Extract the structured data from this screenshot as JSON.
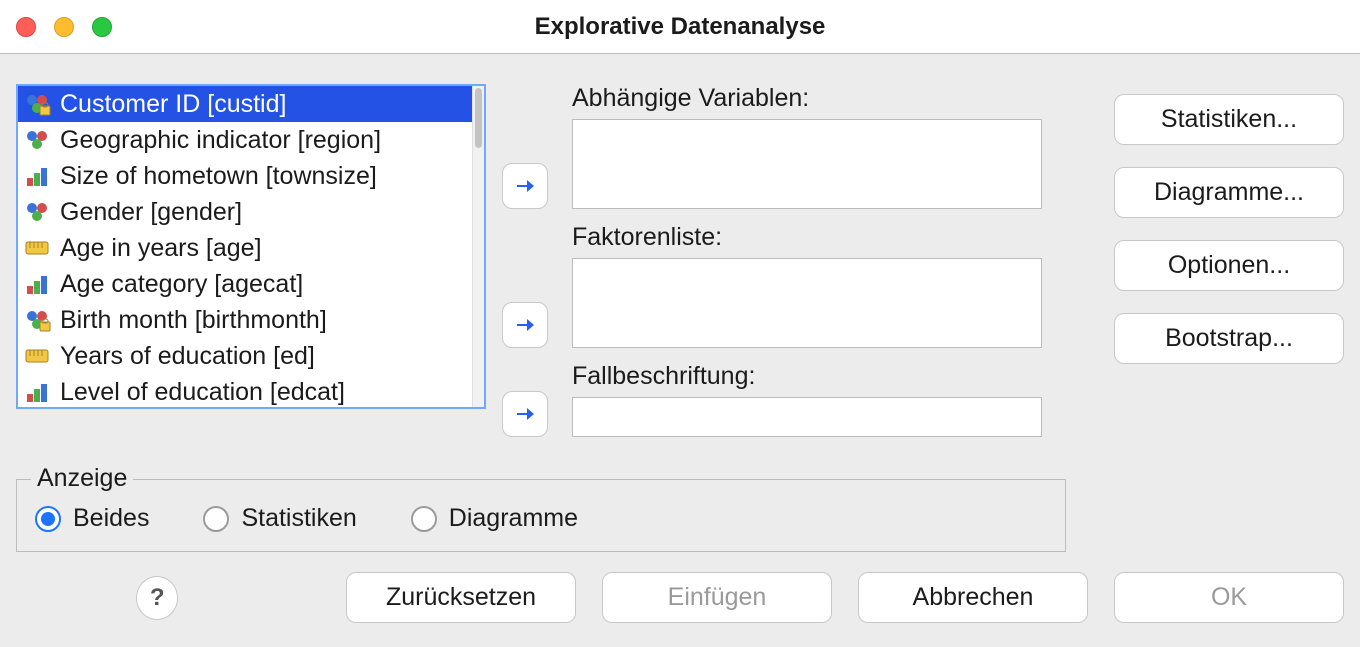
{
  "window": {
    "title": "Explorative Datenanalyse"
  },
  "variables": [
    {
      "label": "Customer ID [custid]",
      "type": "nominal-key",
      "selected": true
    },
    {
      "label": "Geographic indicator [region]",
      "type": "nominal",
      "selected": false
    },
    {
      "label": "Size of hometown [townsize]",
      "type": "ordinal",
      "selected": false
    },
    {
      "label": "Gender [gender]",
      "type": "nominal",
      "selected": false
    },
    {
      "label": "Age in years [age]",
      "type": "scale",
      "selected": false
    },
    {
      "label": "Age category [agecat]",
      "type": "ordinal",
      "selected": false
    },
    {
      "label": "Birth month [birthmonth]",
      "type": "nominal-key",
      "selected": false
    },
    {
      "label": "Years of education [ed]",
      "type": "scale",
      "selected": false
    },
    {
      "label": "Level of education [edcat]",
      "type": "ordinal",
      "selected": false
    }
  ],
  "targets": {
    "dependent_label": "Abhängige Variablen:",
    "factor_label": "Faktorenliste:",
    "caselabel_label": "Fallbeschriftung:"
  },
  "side_buttons": {
    "stats": "Statistiken...",
    "plots": "Diagramme...",
    "options": "Optionen...",
    "bootstrap": "Bootstrap..."
  },
  "display_group": {
    "title": "Anzeige",
    "options": {
      "both": "Beides",
      "stats": "Statistiken",
      "plots": "Diagramme"
    },
    "selected": "both"
  },
  "bottom": {
    "help": "?",
    "reset": "Zurücksetzen",
    "paste": "Einfügen",
    "cancel": "Abbrechen",
    "ok": "OK"
  }
}
